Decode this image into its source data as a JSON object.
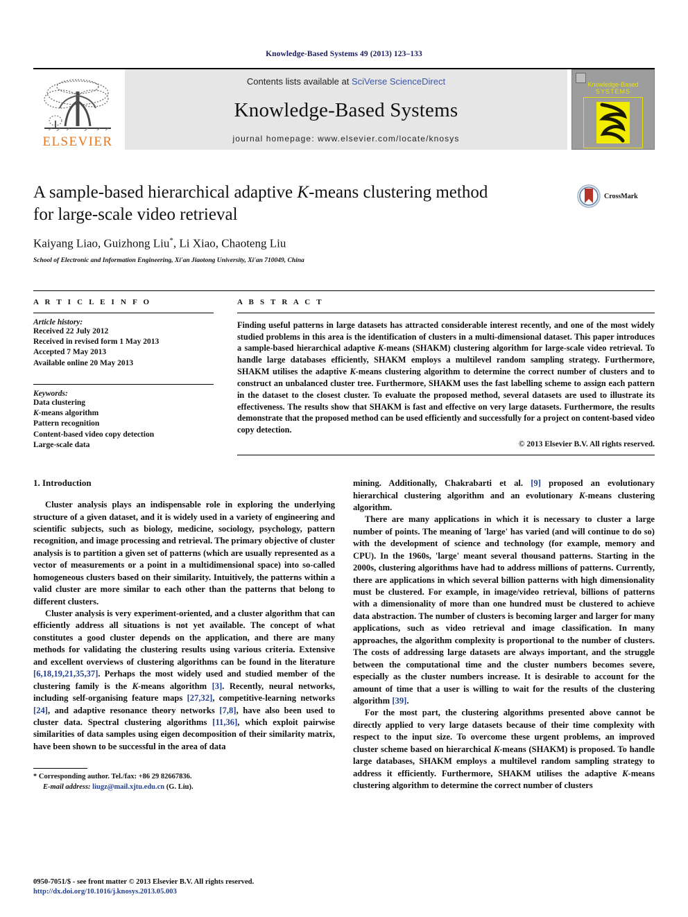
{
  "running_head": "Knowledge-Based Systems 49 (2013) 123–133",
  "masthead": {
    "publisher_name": "ELSEVIER",
    "contents_prefix": "Contents lists available at ",
    "contents_link": "SciVerse ScienceDirect",
    "journal_title": "Knowledge-Based Systems",
    "homepage": "journal homepage: www.elsevier.com/locate/knosys",
    "cover_title_line1": "Knowledge-Based",
    "cover_title_line2": "SYSTEMS"
  },
  "article": {
    "title_line1_a": "A sample-based hierarchical adaptive ",
    "title_line1_italic": "K",
    "title_line1_b": "-means clustering method",
    "title_line2": "for large-scale video retrieval",
    "authors": "Kaiyang Liao, Guizhong Liu",
    "authors_star": "*",
    "authors_rest": ", Li Xiao, Chaoteng Liu",
    "affiliation": "School of Electronic and Information Engineering, Xi'an Jiaotong University, Xi'an 710049, China",
    "crossmark_label": "CrossMark"
  },
  "article_info": {
    "heading": "A R T I C L E    I N F O",
    "history_label": "Article history:",
    "history": [
      "Received 22 July 2012",
      "Received in revised form 1 May 2013",
      "Accepted 7 May 2013",
      "Available online 20 May 2013"
    ],
    "keywords_label": "Keywords:",
    "keywords": [
      "Data clustering",
      "K-means algorithm",
      "Pattern recognition",
      "Content-based video copy detection",
      "Large-scale data"
    ]
  },
  "abstract": {
    "heading": "A B S T R A C T",
    "text_part1": "Finding useful patterns in large datasets has attracted considerable interest recently, and one of the most widely studied problems in this area is the identification of clusters in a multi-dimensional dataset. This paper introduces a sample-based hierarchical adaptive ",
    "italic1": "K",
    "text_part2": "-means (SHAKM) clustering algorithm for large-scale video retrieval. To handle large databases efficiently, SHAKM employs a multilevel random sampling strategy. Furthermore, SHAKM utilises the adaptive ",
    "italic2": "K",
    "text_part3": "-means clustering algorithm to determine the correct number of clusters and to construct an unbalanced cluster tree. Furthermore, SHAKM uses the fast labelling scheme to assign each pattern in the dataset to the closest cluster. To evaluate the proposed method, several datasets are used to illustrate its effectiveness. The results show that SHAKM is fast and effective on very large datasets. Furthermore, the results demonstrate that the proposed method can be used efficiently and successfully for a project on content-based video copy detection.",
    "copyright": "© 2013 Elsevier B.V. All rights reserved."
  },
  "section": {
    "heading": "1. Introduction"
  },
  "left_column": {
    "para1_a": "Cluster analysis plays an indispensable role in exploring the underlying structure of a given dataset, and it is widely used in a variety of engineering and scientific subjects, such as biology, medicine, sociology, psychology, pattern recognition, and image processing and retrieval. The primary objective of cluster analysis is to partition a given set of patterns (which are usually represented as a vector of measurements or a point in a multidimensional space) into so-called homogeneous clusters based on their similarity. Intuitively, the patterns within a valid cluster are more similar to each other than the patterns that belong to different clusters.",
    "para2_a": "Cluster analysis is very experiment-oriented, and a cluster algorithm that can efficiently address all situations is not yet available. The concept of what constitutes a good cluster depends on the application, and there are many methods for validating the clustering results using various criteria. Extensive and excellent overviews of clustering algorithms can be found in the literature ",
    "cite1": "[6,18,19,21,35,37]",
    "para2_b": ". Perhaps the most widely used and studied member of the clustering family is the ",
    "italic_k1": "K",
    "para2_c": "-means algorithm ",
    "cite2": "[3]",
    "para2_d": ". Recently, neural networks, including self-organising feature maps ",
    "cite3": "[27,32]",
    "para2_e": ", competitive-learning networks ",
    "cite4": "[24]",
    "para2_f": ", and adaptive resonance theory networks ",
    "cite5": "[7,8]",
    "para2_g": ", have also been used to cluster data. Spectral clustering algorithms ",
    "cite6": "[11,36]",
    "para2_h": ", which exploit pairwise similarities of data samples using eigen decomposition of their similarity matrix, have been shown to be successful in the area of data"
  },
  "right_column": {
    "para_cont_a": "mining. Additionally, Chakrabarti et al. ",
    "cite7": "[9]",
    "para_cont_b": " proposed an evolutionary hierarchical clustering algorithm and an evolutionary ",
    "italic_k2": "K",
    "para_cont_c": "-means clustering algorithm.",
    "para2_a": "There are many applications in which it is necessary to cluster a large number of points. The meaning of 'large' has varied (and will continue to do so) with the development of science and technology (for example, memory and CPU). In the 1960s, 'large' meant several thousand patterns. Starting in the 2000s, clustering algorithms have had to address millions of patterns. Currently, there are applications in which several billion patterns with high dimensionality must be clustered. For example, in image/video retrieval, billions of patterns with a dimensionality of more than one hundred must be clustered to achieve data abstraction. The number of clusters is becoming larger and larger for many applications, such as video retrieval and image classification. In many approaches, the algorithm complexity is proportional to the number of clusters. The costs of addressing large datasets are always important, and the struggle between the computational time and the cluster numbers becomes severe, especially as the cluster numbers increase. It is desirable to account for the amount of time that a user is willing to wait for the results of the clustering algorithm ",
    "cite8": "[39]",
    "para2_b": ".",
    "para3_a": "For the most part, the clustering algorithms presented above cannot be directly applied to very large datasets because of their time complexity with respect to the input size. To overcome these urgent problems, an improved cluster scheme based on hierarchical ",
    "italic_k3": "K",
    "para3_b": "-means (SHAKM) is proposed. To handle large databases, SHAKM employs a multilevel random sampling strategy to address it efficiently. Furthermore, SHAKM utilises the adaptive ",
    "italic_k4": "K",
    "para3_c": "-means clustering algorithm to determine the correct number of clusters"
  },
  "footnote": {
    "star": "*",
    "corresponding": " Corresponding author. Tel./fax: +86 29 82667836.",
    "email_label": "E-mail address:",
    "email": " liugz@mail.xjtu.edu.cn",
    "email_suffix": " (G. Liu)."
  },
  "page_footer": {
    "issn_line": "0950-7051/$ - see front matter © 2013 Elsevier B.V. All rights reserved.",
    "doi": "http://dx.doi.org/10.1016/j.knosys.2013.05.003"
  },
  "colors": {
    "link_blue": "#3b57a8",
    "cite_blue": "#24418e",
    "running_head_navy": "#1a1a5e",
    "elsevier_orange": "#e8761a",
    "cover_grey": "#9d9d9d",
    "cover_yellow": "#f2ec00",
    "masthead_grey": "#e6e6e6"
  }
}
